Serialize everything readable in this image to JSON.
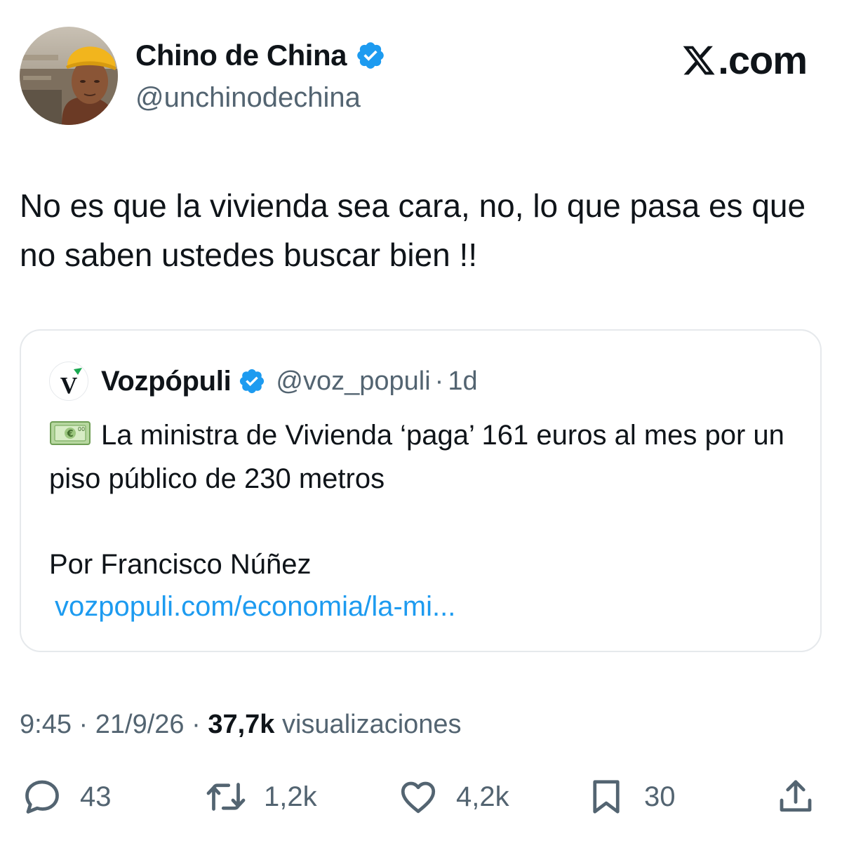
{
  "author": {
    "display_name": "Chino de China",
    "handle": "@unchinodechina",
    "verified": true
  },
  "brand": {
    "text": ".com",
    "icon": "x-logo-icon"
  },
  "tweet": {
    "text": "No es que la vivienda sea cara, no, lo que pasa es que no saben ustedes buscar bien !!"
  },
  "quote": {
    "avatar_letter": "V",
    "display_name": "Vozpópuli",
    "handle": "@voz_populi",
    "separator": "·",
    "time": "1d",
    "emoji": "money-with-wings-icon",
    "text": "La ministra de Vivienda ‘paga’ 161 euros al mes por un piso público de 230 metros",
    "author_line": "Por Francisco Núñez",
    "link": "vozpopuli.com/economia/la-mi..."
  },
  "meta": {
    "time": "9:45",
    "date": "21/9/26",
    "views_count": "37,7k",
    "views_label": "visualizaciones",
    "separator": "·"
  },
  "actions": {
    "replies": "43",
    "retweets": "1,2k",
    "likes": "4,2k",
    "bookmarks": "30"
  },
  "colors": {
    "text": "#0f1419",
    "secondary": "#536471",
    "link": "#1d9bf0",
    "verified": "#1d9bf0",
    "border": "#e6e9ec",
    "vozpopuli_green": "#1aa851"
  }
}
